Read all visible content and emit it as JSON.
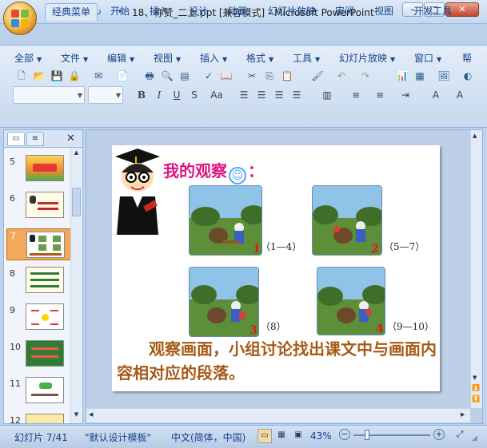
{
  "window": {
    "title": "18、称赞_二上.ppt [兼容模式] - Microsoft PowerPoint",
    "qat_separator": "▾"
  },
  "ribbon_tabs": [
    "经典菜单",
    "开始",
    "插入",
    "设计",
    "动画",
    "幻灯片放映",
    "审阅",
    "视图",
    "开发工具"
  ],
  "classic_menus": [
    "全部",
    "文件",
    "编辑",
    "视图",
    "插入",
    "格式",
    "工具",
    "幻灯片放映",
    "窗口",
    "帮"
  ],
  "thumbnails": [
    {
      "num": "5"
    },
    {
      "num": "6"
    },
    {
      "num": "7"
    },
    {
      "num": "8"
    },
    {
      "num": "9"
    },
    {
      "num": "10"
    },
    {
      "num": "11"
    },
    {
      "num": "12"
    }
  ],
  "slide": {
    "heading": "我的观察",
    "heading_suffix": "：",
    "pictures": [
      {
        "num": "1",
        "range": "（1—4）"
      },
      {
        "num": "2",
        "range": "（5—7）"
      },
      {
        "num": "3",
        "range": "（8）"
      },
      {
        "num": "4",
        "range": "（9—10）"
      }
    ],
    "body": "观察画面，小组讨论找出课文中与画面内容相对应的段落。"
  },
  "status": {
    "slide_info": "幻灯片 7/41",
    "template": "\"默认设计模板\"",
    "language": "中文(简体，中国)",
    "zoom": "43%"
  },
  "colors": {
    "heading": "#e0147f",
    "body": "#a75a16",
    "number": "#e3161b"
  }
}
